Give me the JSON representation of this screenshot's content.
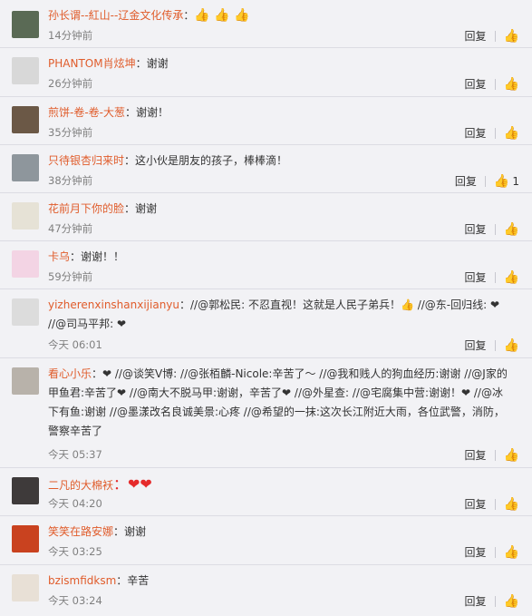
{
  "comments": [
    {
      "user": "孙长谓--紅山--辽金文化传承",
      "text": "：",
      "emoji": "👍 👍 👍",
      "time": "14分钟前",
      "reply": "回复",
      "avatar": "#5a6a55"
    },
    {
      "user": "PHANTOM肖炫坤",
      "text": "：谢谢",
      "time": "26分钟前",
      "reply": "回复",
      "avatar": "#d8d8d8"
    },
    {
      "user": "煎饼-卷-卷-大葱",
      "text": "：谢谢！",
      "time": "35分钟前",
      "reply": "回复",
      "avatar": "#6b5846"
    },
    {
      "user": "只待银杏归来时",
      "text": "：这小伙是朋友的孩子，棒棒滴！",
      "time": "38分钟前",
      "reply": "回复",
      "like_count": "1",
      "avatar": "#8e969c"
    },
    {
      "user": "花前月下你的脸",
      "text": "：谢谢",
      "time": "47分钟前",
      "reply": "回复",
      "avatar": "#e6e2d6"
    },
    {
      "user": "卡乌",
      "text": "：谢谢！！",
      "time": "59分钟前",
      "reply": "回复",
      "avatar": "#f3d4e4"
    },
    {
      "user": "yizherenxinshanxijianyu",
      "text": "：//@郭松民: 不忍直视！这就是人民子弟兵！👍 //@东-回归线: ❤ //@司马平邦: ❤",
      "time": "今天 06:01",
      "reply": "回复",
      "avatar": "#dcdcdc"
    },
    {
      "user": "看心小乐",
      "text": "：❤ //@谈笑V博: //@张栢麟-Nicole:辛苦了～ //@我和贱人的狗血经历:谢谢 //@J家的甲鱼君:辛苦了❤ //@南大不脱马甲:谢谢，辛苦了❤ //@外星查: //@宅腐集中营:谢谢！❤ //@冰下有鱼:谢谢 //@墨漾改名良诚美景:心疼 //@希望的一抹:这次长江附近大雨，各位武警，消防，警察辛苦了",
      "time": "今天 05:37",
      "reply": "回复",
      "avatar": "#b8b2aa"
    },
    {
      "user": "二凡的大棉袄",
      "text": "：❤❤",
      "time": "今天 04:20",
      "reply": "回复",
      "avatar": "#3e3a3a"
    },
    {
      "user": "笑笑在路安娜",
      "text": "：谢谢",
      "time": "今天 03:25",
      "reply": "回复",
      "avatar": "#c9421f"
    },
    {
      "user": "bzismfidksm",
      "text": "：辛苦",
      "time": "今天 03:24",
      "reply": "回复",
      "avatar": "#e8e0d6"
    }
  ]
}
